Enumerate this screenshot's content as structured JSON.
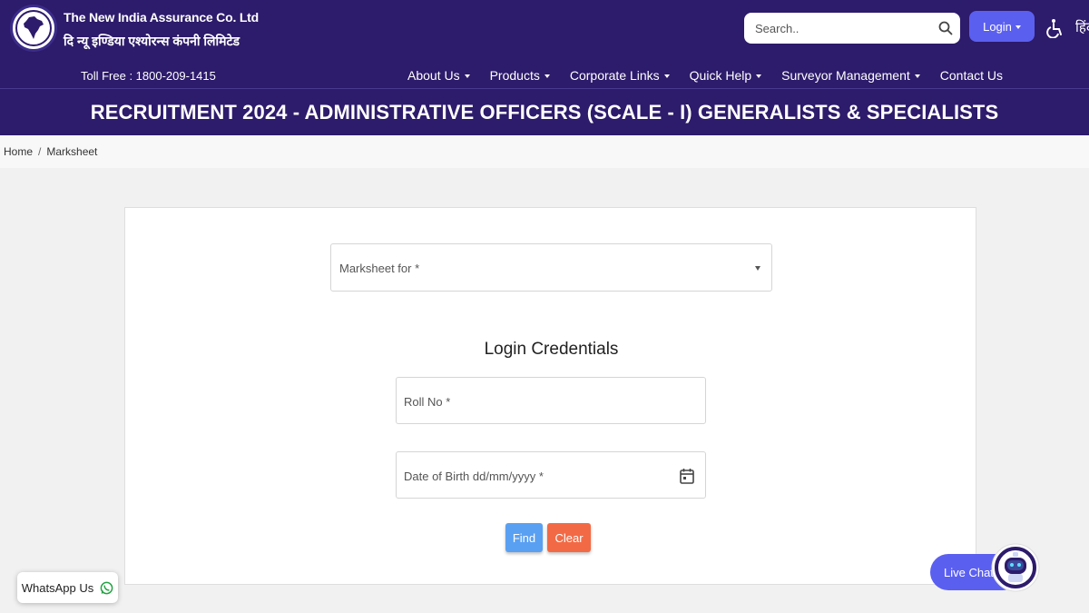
{
  "header": {
    "brand_en": "The New India Assurance Co. Ltd",
    "brand_hi": "दि न्यू इण्डिया एश्योरन्स कंपनी लिमिटेड",
    "toll_free": "Toll Free : 1800-209-1415",
    "search_placeholder": "Search..",
    "login_label": "Login",
    "language_link": "हिंदी",
    "logo_icon": "india-map-seal-icon",
    "accessibility_icon": "wheelchair-icon"
  },
  "nav": {
    "items": [
      {
        "label": "About Us"
      },
      {
        "label": "Products"
      },
      {
        "label": "Corporate Links"
      },
      {
        "label": "Quick Help"
      },
      {
        "label": "Surveyor Management"
      },
      {
        "label": "Contact Us"
      }
    ]
  },
  "page": {
    "title": "RECRUITMENT 2024 - ADMINISTRATIVE OFFICERS (SCALE - I) GENERALISTS & SPECIALISTS"
  },
  "breadcrumb": {
    "home": "Home",
    "separator": "/",
    "current": "Marksheet"
  },
  "form": {
    "marksheet_select": "Marksheet for *",
    "credentials_title": "Login Credentials",
    "roll_no": "Roll No *",
    "dob": "Date of Birth dd/mm/yyyy *",
    "find_label": "Find",
    "clear_label": "Clear"
  },
  "floating": {
    "whatsapp_label": "WhatsApp Us",
    "live_chat_label": "Live Chat"
  },
  "colors": {
    "header_bg": "#2d1b6b",
    "accent": "#5b5ff0",
    "find_btn": "#5aa0f2",
    "clear_btn": "#f26a45"
  }
}
